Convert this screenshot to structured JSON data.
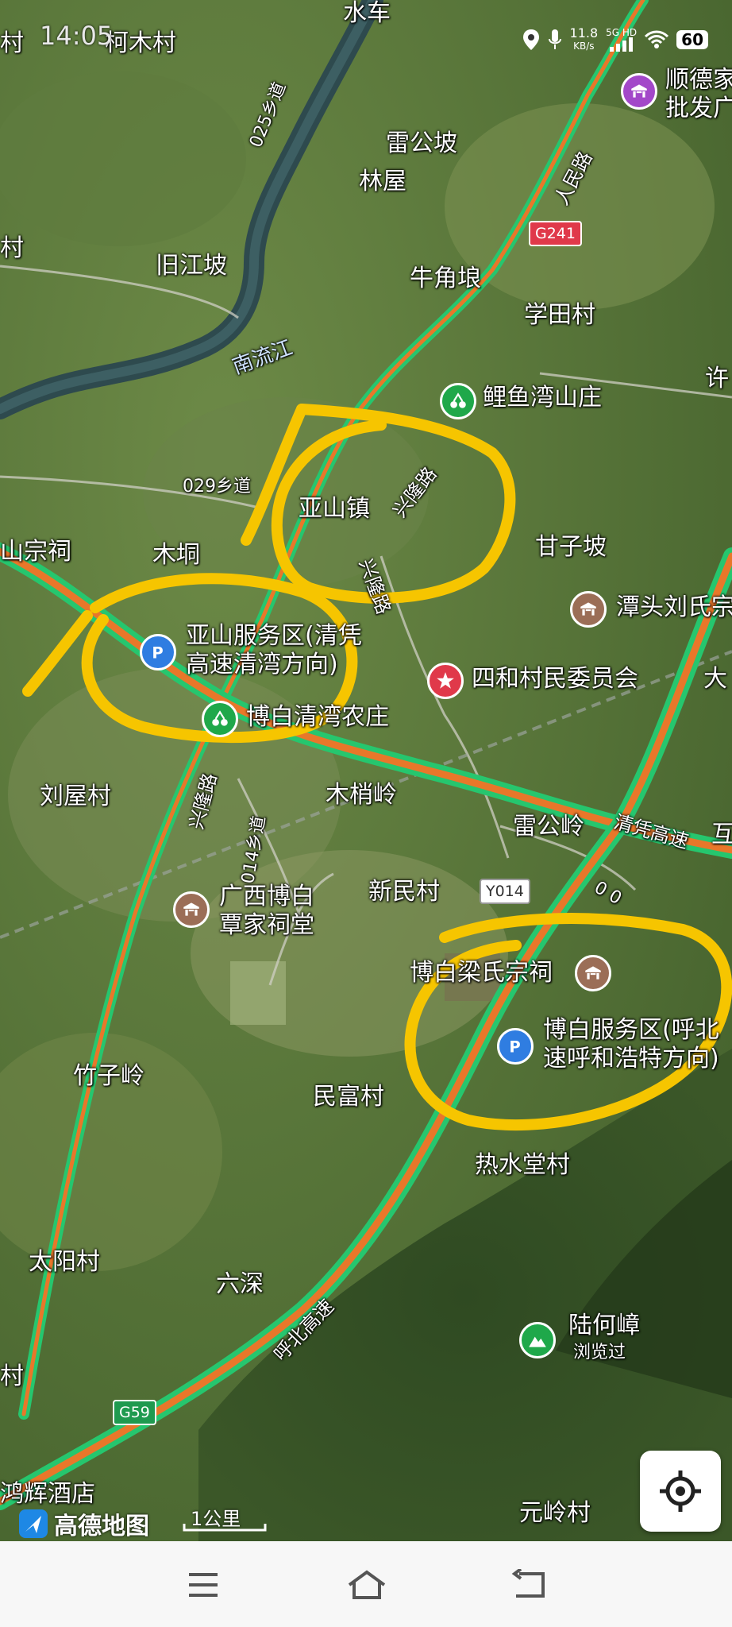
{
  "status_bar": {
    "time": "14:05",
    "speed_value": "11.8",
    "speed_unit": "KB/s",
    "network": "5G HD",
    "battery": "60"
  },
  "places": [
    {
      "id": "shuiche",
      "name": "水车"
    },
    {
      "id": "kemucun",
      "name": "柯木村"
    },
    {
      "id": "leigongpo",
      "name": "雷公坡"
    },
    {
      "id": "linwu",
      "name": "林屋"
    },
    {
      "id": "jiujiangpo",
      "name": "旧江坡"
    },
    {
      "id": "niujiaolang",
      "name": "牛角埌"
    },
    {
      "id": "xuetiancun",
      "name": "学田村"
    },
    {
      "id": "yashanzhen",
      "name": "亚山镇"
    },
    {
      "id": "mudong",
      "name": "木垌"
    },
    {
      "id": "ganzipo",
      "name": "甘子坡"
    },
    {
      "id": "liuwucun",
      "name": "刘屋村"
    },
    {
      "id": "mushaoling",
      "name": "木梢岭"
    },
    {
      "id": "leigongling",
      "name": "雷公岭"
    },
    {
      "id": "xinmincun",
      "name": "新民村"
    },
    {
      "id": "zhuziling",
      "name": "竹子岭"
    },
    {
      "id": "minfucun",
      "name": "民富村"
    },
    {
      "id": "reshuitangcun",
      "name": "热水堂村"
    },
    {
      "id": "taiyangcun",
      "name": "太阳村"
    },
    {
      "id": "liushen",
      "name": "六深"
    },
    {
      "id": "yuanlingcun",
      "name": "元岭村"
    },
    {
      "id": "edge_cun1",
      "name": "村"
    },
    {
      "id": "edge_cun2",
      "name": "村"
    },
    {
      "id": "edge_cun3",
      "name": "村"
    },
    {
      "id": "edge_xu",
      "name": "许"
    },
    {
      "id": "edge_da",
      "name": "大"
    },
    {
      "id": "edge_hu",
      "name": "互"
    },
    {
      "id": "shanzongci",
      "name": "山宗祠"
    },
    {
      "id": "honghuijiudian",
      "name": "鸿辉酒店"
    }
  ],
  "roads": {
    "r025": "025乡道",
    "r029": "029乡道",
    "r014": "014乡道",
    "r0": "0 0",
    "xinglong_a": "兴隆路",
    "xinglong_b": "兴隆路",
    "xinglong_c": "兴隆路",
    "renmin": "人民路",
    "qingping": "清凭高速",
    "hubei": "呼北高速",
    "river": "南流江",
    "g241": "G241",
    "y014": "Y014",
    "g59": "G59"
  },
  "pois": [
    {
      "id": "shunde",
      "name": "顺德家",
      "sub": "批发广",
      "icon": "gate-icon",
      "color": "#a348c9"
    },
    {
      "id": "liyuwan",
      "name": "鲤鱼湾山庄",
      "icon": "cherry-icon",
      "color": "#1fa84a"
    },
    {
      "id": "tantou",
      "name": "潭头刘氏宗",
      "icon": "gate-icon",
      "color": "#9b6e57"
    },
    {
      "id": "sihe",
      "name": "四和村民委员会",
      "icon": "star-icon",
      "color": "#e0394a"
    },
    {
      "id": "yashan_sa",
      "name": "亚山服务区(清凭",
      "sub": "高速清湾方向)",
      "icon": "parking-icon",
      "color": "#2f7de1"
    },
    {
      "id": "bobai_farm",
      "name": "博白清湾农庄",
      "icon": "cherry-icon",
      "color": "#1fa84a"
    },
    {
      "id": "tanjia",
      "name": "广西博白",
      "sub": "覃家祠堂",
      "icon": "gate-icon",
      "color": "#9b6e57"
    },
    {
      "id": "liangshi",
      "name": "博白梁氏宗祠",
      "icon": "gate-icon",
      "color": "#9b6e57"
    },
    {
      "id": "bobai_sa",
      "name": "博白服务区(呼北",
      "sub": "速呼和浩特方向)",
      "icon": "parking-icon",
      "color": "#2f7de1"
    },
    {
      "id": "luhezhang",
      "name": "陆何嶂",
      "sub": "浏览过",
      "icon": "mountain-icon",
      "color": "#1fa84a"
    }
  ],
  "brand": "高德地图",
  "scale": "1公里",
  "colors": {
    "highway_fill": "#e8772a",
    "highway_edge": "#26c66e",
    "annotation": "#f6c500"
  }
}
